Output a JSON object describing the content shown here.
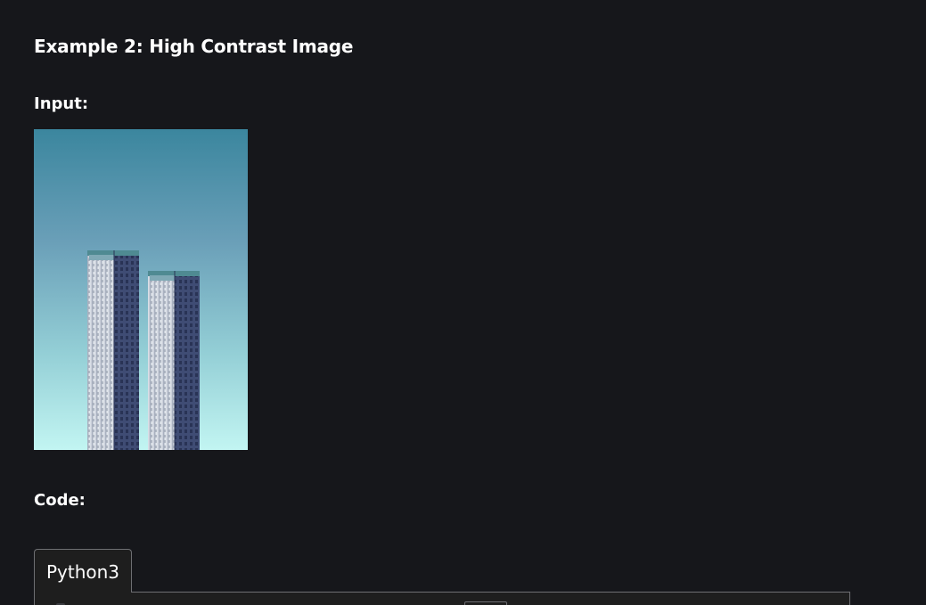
{
  "example_heading": "Example 2: High Contrast Image",
  "input_heading": "Input:",
  "input_image": {
    "subject": "two-skyscrapers-photo",
    "sky_colors": [
      "#3b869e",
      "#7fb7c4",
      "#c2f5f2"
    ],
    "tower_colors": [
      "#dfe4ea",
      "#3c4a72"
    ]
  },
  "code_heading": "Code:",
  "code_block": {
    "tabs": [
      {
        "label": "Python3",
        "active": true
      }
    ]
  },
  "colors": {
    "background": "#16171b",
    "text": "#ffffff",
    "panel": "#1e1e1e",
    "panel_border": "#6e6f73"
  }
}
